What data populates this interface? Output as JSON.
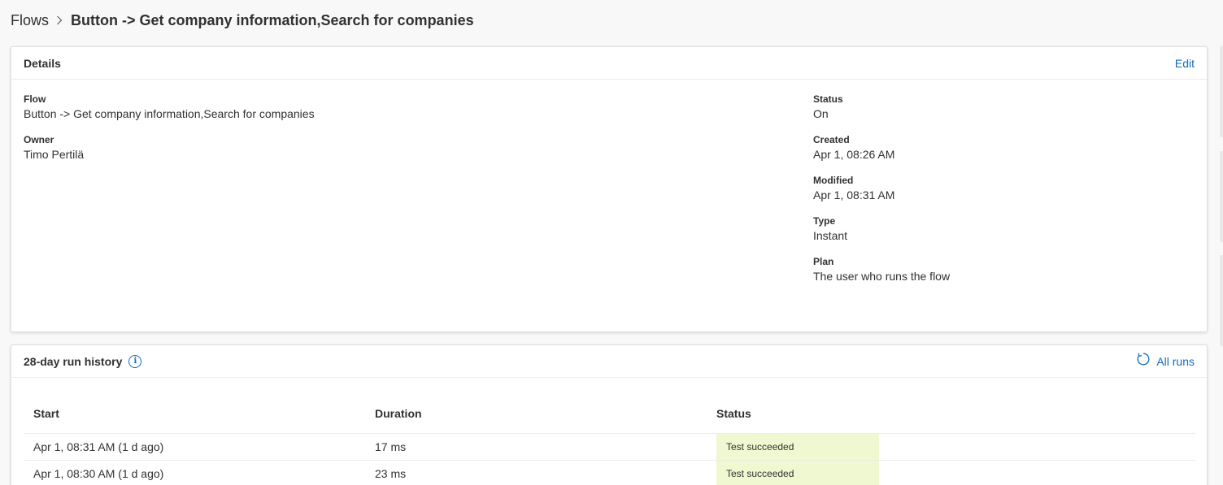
{
  "breadcrumb": {
    "root": "Flows",
    "current": "Button -> Get company information,Search for companies"
  },
  "details": {
    "title": "Details",
    "edit_label": "Edit",
    "left_fields": [
      {
        "label": "Flow",
        "value": "Button -> Get company information,Search for companies"
      },
      {
        "label": "Owner",
        "value": "Timo Pertilä"
      }
    ],
    "right_fields": [
      {
        "label": "Status",
        "value": "On"
      },
      {
        "label": "Created",
        "value": "Apr 1, 08:26 AM"
      },
      {
        "label": "Modified",
        "value": "Apr 1, 08:31 AM"
      },
      {
        "label": "Type",
        "value": "Instant"
      },
      {
        "label": "Plan",
        "value": "The user who runs the flow"
      }
    ]
  },
  "history": {
    "title": "28-day run history",
    "info_icon": "info-icon",
    "all_runs_label": "All runs",
    "columns": [
      "Start",
      "Duration",
      "Status"
    ],
    "rows": [
      {
        "start": "Apr 1, 08:31 AM (1 d ago)",
        "duration": "17 ms",
        "status": "Test succeeded"
      },
      {
        "start": "Apr 1, 08:30 AM (1 d ago)",
        "duration": "23 ms",
        "status": "Test succeeded"
      }
    ]
  },
  "colors": {
    "accent": "#0f6cbd",
    "success_bg": "#eff8d0"
  }
}
